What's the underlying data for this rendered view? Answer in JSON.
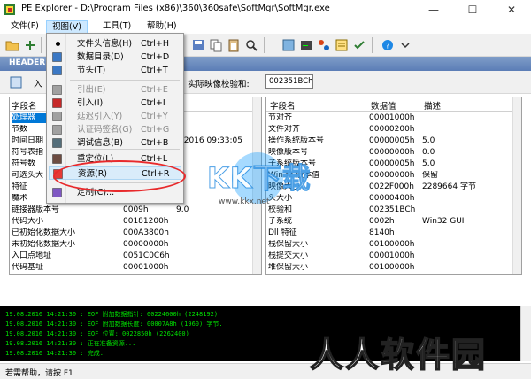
{
  "window": {
    "title": "PE Explorer - D:\\Program Files (x86)\\360\\360safe\\SoftMgr\\SoftMgr.exe",
    "minimize": "—",
    "maximize": "☐",
    "close": "✕"
  },
  "menubar": [
    {
      "label": "文件(F)"
    },
    {
      "label": "视图(V)"
    },
    {
      "label": "工具(T)"
    },
    {
      "label": "帮助(H)"
    }
  ],
  "header_strip": {
    "label": "HEADER"
  },
  "subbar": {
    "toolbar_text": "入",
    "checksum_label": "实际映像校验和:",
    "checksum_value": "002351BCh"
  },
  "view_menu": [
    {
      "label": "文件头信息(H)",
      "shortcut": "Ctrl+H",
      "checked": true,
      "disabled": false,
      "icon": "file-header-icon"
    },
    {
      "label": "数据目录(D)",
      "shortcut": "Ctrl+D",
      "disabled": false,
      "icon": "data-directory-icon"
    },
    {
      "label": "节头(T)",
      "shortcut": "Ctrl+T",
      "disabled": false,
      "icon": "section-header-icon"
    },
    {
      "label": "引出(E)",
      "shortcut": "Ctrl+E",
      "disabled": true,
      "icon": "exports-icon"
    },
    {
      "label": "引入(I)",
      "shortcut": "Ctrl+I",
      "disabled": false,
      "icon": "imports-icon"
    },
    {
      "label": "延迟引入(Y)",
      "shortcut": "Ctrl+Y",
      "disabled": true,
      "icon": "delay-import-icon"
    },
    {
      "label": "认证码签名(G)",
      "shortcut": "Ctrl+G",
      "disabled": true,
      "icon": "signature-icon"
    },
    {
      "label": "调试信息(B)",
      "shortcut": "Ctrl+B",
      "disabled": false,
      "icon": "debug-icon"
    },
    {
      "label": "重定位(L)",
      "shortcut": "Ctrl+L",
      "disabled": false,
      "icon": "relocation-icon"
    },
    {
      "label": "资源(R)",
      "shortcut": "Ctrl+R",
      "disabled": false,
      "highlighted": true,
      "icon": "resources-icon"
    },
    {
      "label": "定制(C)...",
      "shortcut": "",
      "disabled": false,
      "icon": "customize-icon"
    }
  ],
  "left_table": {
    "headers": [
      "字段名",
      "",
      ""
    ],
    "rows": [
      {
        "name": "处理器",
        "value": "",
        "desc": "",
        "selected": true
      },
      {
        "name": "节数",
        "value": "",
        "desc": ""
      },
      {
        "name": "时间日期",
        "value": "",
        "desc": "7/2016 09:33:05"
      },
      {
        "name": "符号表指",
        "value": "",
        "desc": ""
      },
      {
        "name": "符号数",
        "value": "",
        "desc": ""
      },
      {
        "name": "可选头大",
        "value": "",
        "desc": ""
      },
      {
        "name": "特征",
        "value": "",
        "desc": ""
      },
      {
        "name": "魔术",
        "value": "",
        "desc": ""
      },
      {
        "name": "链接器版本号",
        "value": "0009h",
        "desc": "9.0"
      },
      {
        "name": "代码大小",
        "value": "00181200h",
        "desc": ""
      },
      {
        "name": "已初始化数据大小",
        "value": "000A3800h",
        "desc": ""
      },
      {
        "name": "未初始化数据大小",
        "value": "00000000h",
        "desc": ""
      },
      {
        "name": "入口点地址",
        "value": "0051C0C6h",
        "desc": ""
      },
      {
        "name": "代码基址",
        "value": "00001000h",
        "desc": ""
      }
    ]
  },
  "right_table": {
    "headers": [
      "字段名",
      "数据值",
      "描述"
    ],
    "rows": [
      {
        "name": "节对齐",
        "value": "00001000h",
        "desc": ""
      },
      {
        "name": "文件对齐",
        "value": "00000200h",
        "desc": ""
      },
      {
        "name": "操作系统版本号",
        "value": "00000005h",
        "desc": "5.0"
      },
      {
        "name": "映像版本号",
        "value": "00000000h",
        "desc": "0.0"
      },
      {
        "name": "子系统版本号",
        "value": "00000005h",
        "desc": "5.0"
      },
      {
        "name": "Win32 版本值",
        "value": "00000000h",
        "desc": "保留"
      },
      {
        "name": "映像大小",
        "value": "0022F000h",
        "desc": "2289664 字节"
      },
      {
        "name": "头大小",
        "value": "00000400h",
        "desc": ""
      },
      {
        "name": "校验和",
        "value": "002351BCh",
        "desc": ""
      },
      {
        "name": "子系统",
        "value": "0002h",
        "desc": "Win32 GUI"
      },
      {
        "name": "Dll 特征",
        "value": "8140h",
        "desc": ""
      },
      {
        "name": "栈保留大小",
        "value": "00100000h",
        "desc": ""
      },
      {
        "name": "栈提交大小",
        "value": "00001000h",
        "desc": ""
      },
      {
        "name": "堆保留大小",
        "value": "00100000h",
        "desc": ""
      }
    ]
  },
  "log": [
    "19.08.2016 14:21:30 : EOF 附加数据指针: 00224600h  (2248192)",
    "19.08.2016 14:21:30 : EOF 附加数据长度: 00007A8h  (1960) 字节.",
    "19.08.2016 14:21:30 : EOF 位置: 0022850h  (2262400)",
    "19.08.2016 14:21:30 : 正在准备资源...",
    "19.08.2016 14:21:30 : 完成."
  ],
  "statusbar": {
    "text": "若需帮助，请按 F1"
  },
  "watermarks": {
    "big": "KK下载",
    "small": "www.kkx.net",
    "bottom": "人人软件园"
  },
  "colors": {
    "accent": "#0078d7",
    "menu_highlight": "#d9ecfa",
    "annotation": "#e8292b",
    "log_text": "#00e000",
    "header_strip": "#5b7db6"
  }
}
